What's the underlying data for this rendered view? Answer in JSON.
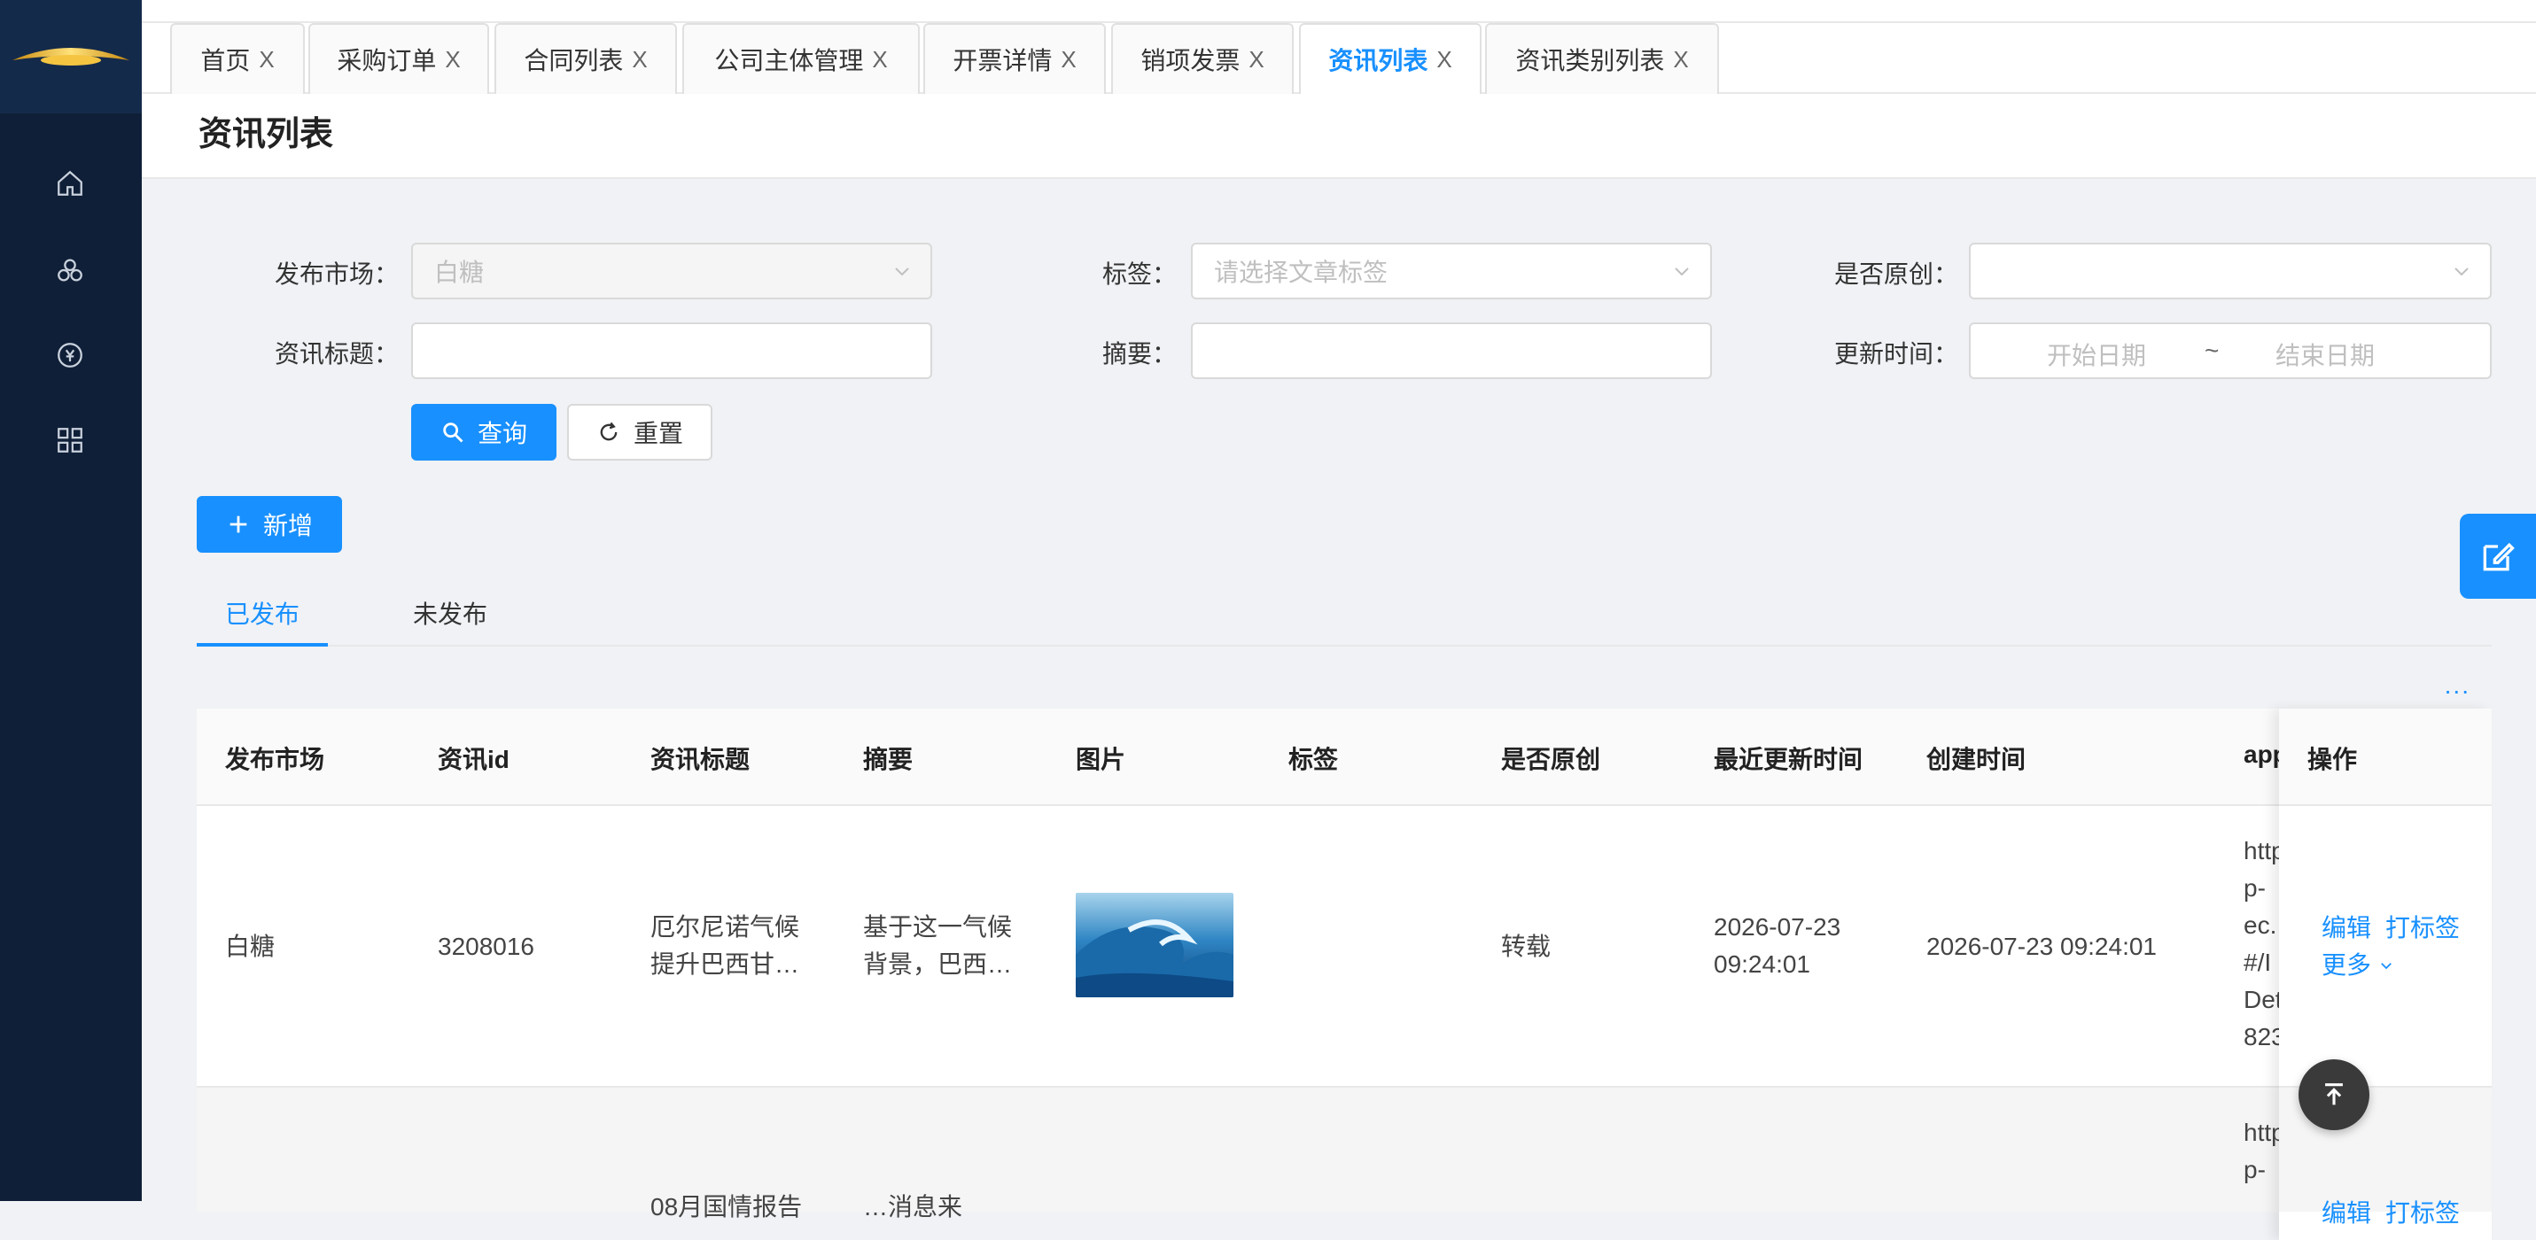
{
  "tabs": [
    {
      "label": "首页",
      "active": false
    },
    {
      "label": "采购订单",
      "active": false
    },
    {
      "label": "合同列表",
      "active": false
    },
    {
      "label": "公司主体管理",
      "active": false
    },
    {
      "label": "开票详情",
      "active": false
    },
    {
      "label": "销项发票",
      "active": false
    },
    {
      "label": "资讯列表",
      "active": true
    },
    {
      "label": "资讯类别列表",
      "active": false
    }
  ],
  "tab_close": "X",
  "page_title": "资讯列表",
  "filters": {
    "market_label": "发布市场：",
    "market_value": "白糖",
    "tag_label": "标签：",
    "tag_placeholder": "请选择文章标签",
    "original_label": "是否原创：",
    "title_label": "资讯标题：",
    "summary_label": "摘要：",
    "update_time_label": "更新时间：",
    "start_date_placeholder": "开始日期",
    "range_sep": "~",
    "end_date_placeholder": "结束日期"
  },
  "buttons": {
    "search": "查询",
    "reset": "重置",
    "add": "新增"
  },
  "subtabs": [
    {
      "label": "已发布",
      "active": true
    },
    {
      "label": "未发布",
      "active": false
    }
  ],
  "more_dots": "...",
  "table": {
    "headers": [
      "发布市场",
      "资讯id",
      "资讯标题",
      "摘要",
      "图片",
      "标签",
      "是否原创",
      "最近更新时间",
      "创建时间",
      "app",
      "操作"
    ],
    "rows": [
      {
        "market": "白糖",
        "id": "3208016",
        "title": "厄尔尼诺气候提升巴西甘…",
        "summary": "基于这一气候背景，巴西…",
        "image": "wave",
        "tag": "",
        "original": "转载",
        "updated": "2026-07-23 09:24:01",
        "created": "2026-07-23 09:24:01",
        "app_link": [
          "http",
          "p-",
          "ec.",
          "#/I",
          "Det",
          "823"
        ]
      },
      {
        "title_partial": "08月国情报告",
        "summary_partial": "…消息来",
        "app_link": [
          "http",
          "p-"
        ]
      }
    ],
    "actions": {
      "edit": "编辑",
      "tag": "打标签",
      "more": "更多"
    }
  },
  "colors": {
    "primary": "#1890ff",
    "sidebar": "#0f1f38"
  }
}
